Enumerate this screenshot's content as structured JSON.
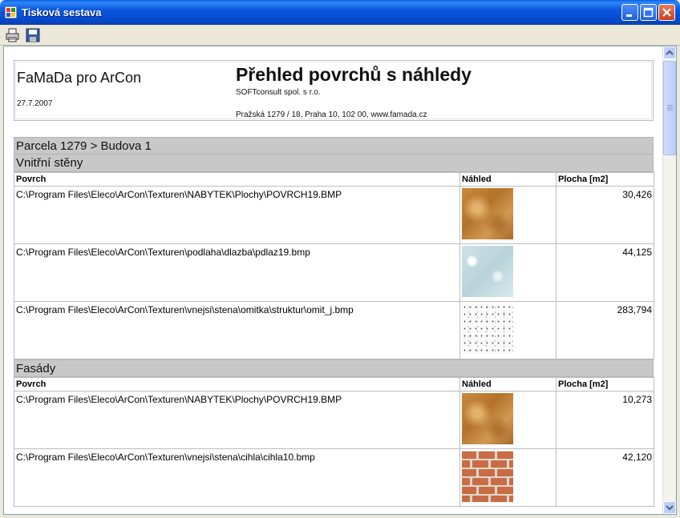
{
  "window": {
    "title": "Tisková sestava"
  },
  "toolbar": {
    "buttons": [
      {
        "icon": "print-icon"
      },
      {
        "icon": "save-icon"
      }
    ]
  },
  "report": {
    "header": {
      "app_name": "FaMaDa pro ArCon",
      "date": "27.7.2007",
      "title": "Přehled povrchů s náhledy",
      "company": "SOFTconsult spol. s r.o.",
      "address": "Pražská 1279 / 18, Praha 10, 102 00, www.famada.cz"
    },
    "parcel": "Parcela 1279 > Budova 1",
    "columns": {
      "surface": "Povrch",
      "preview": "Náhled",
      "area": "Plocha [m2]"
    },
    "sections": [
      {
        "name": "Vnitřní stěny",
        "rows": [
          {
            "path": "C:\\Program Files\\Eleco\\ArCon\\Texturen\\NABYTEK\\Plochy\\POVRCH19.BMP",
            "texture": "wood",
            "area": "30,426"
          },
          {
            "path": "C:\\Program Files\\Eleco\\ArCon\\Texturen\\podlaha\\dlazba\\pdlaz19.bmp",
            "texture": "tile",
            "area": "44,125"
          },
          {
            "path": "C:\\Program Files\\Eleco\\ArCon\\Texturen\\vnejsi\\stena\\omitka\\struktur\\omit_j.bmp",
            "texture": "plaster",
            "area": "283,794"
          }
        ]
      },
      {
        "name": "Fasády",
        "rows": [
          {
            "path": "C:\\Program Files\\Eleco\\ArCon\\Texturen\\NABYTEK\\Plochy\\POVRCH19.BMP",
            "texture": "wood",
            "area": "10,273"
          },
          {
            "path": "C:\\Program Files\\Eleco\\ArCon\\Texturen\\vnejsi\\stena\\cihla\\cihla10.bmp",
            "texture": "brick",
            "area": "42,120"
          }
        ]
      }
    ]
  },
  "colors": {
    "titlebar": "#0A5FE8",
    "band": "#C8C8C8",
    "window_bg": "#ECE9D8"
  }
}
